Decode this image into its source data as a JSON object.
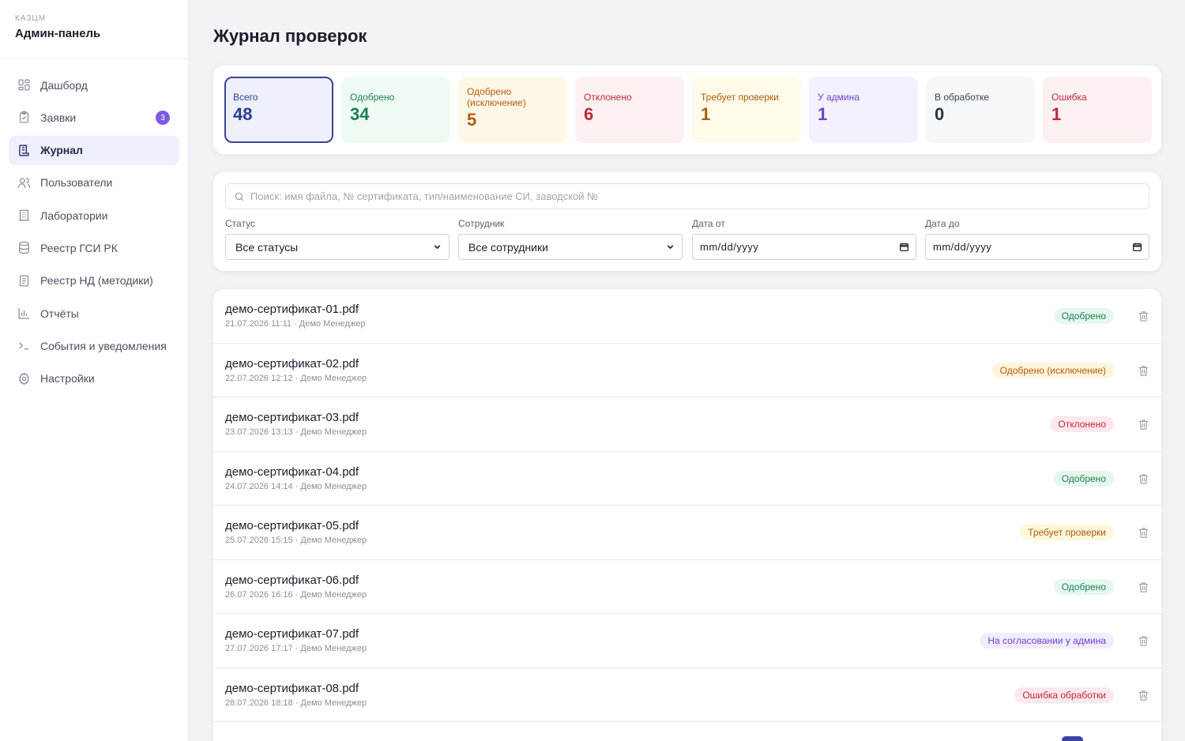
{
  "sidebar": {
    "brand_small": "КАЗЦМ",
    "brand_title": "Админ-панель",
    "items": [
      {
        "label": "Дашборд",
        "icon": "dashboard-icon"
      },
      {
        "label": "Заявки",
        "icon": "clipboard-icon",
        "badge": "3"
      },
      {
        "label": "Журнал",
        "icon": "journal-icon",
        "active": true
      },
      {
        "label": "Пользователи",
        "icon": "users-icon"
      },
      {
        "label": "Лаборатории",
        "icon": "building-icon"
      },
      {
        "label": "Реестр ГСИ РК",
        "icon": "database-icon"
      },
      {
        "label": "Реестр НД (методики)",
        "icon": "document-icon"
      },
      {
        "label": "Отчёты",
        "icon": "bar-chart-icon"
      },
      {
        "label": "События и уведомления",
        "icon": "terminal-icon"
      },
      {
        "label": "Настройки",
        "icon": "gear-icon"
      }
    ]
  },
  "main": {
    "title": "Журнал проверок"
  },
  "stats": [
    {
      "label": "Всего",
      "value": "48",
      "bg": "#eef0fc",
      "fg": "#2c3d8f",
      "label_color": "#2c3d8f"
    },
    {
      "label": "Одобрено",
      "value": "34",
      "bg": "#eefbf3",
      "fg": "#1b7f53",
      "label_color": "#1b7f53"
    },
    {
      "label": "Одобрено (исключение)",
      "value": "5",
      "bg": "#fff8e8",
      "fg": "#b45a09",
      "label_color": "#b45a09"
    },
    {
      "label": "Отклонено",
      "value": "6",
      "bg": "#fdf0f1",
      "fg": "#c2273a",
      "label_color": "#c2273a"
    },
    {
      "label": "Требует проверки",
      "value": "1",
      "bg": "#fffaea",
      "fg": "#a8600a",
      "label_color": "#a8600a"
    },
    {
      "label": "У админа",
      "value": "1",
      "bg": "#f3f1fd",
      "fg": "#6d3fd1",
      "label_color": "#6d3fd1"
    },
    {
      "label": "В обработке",
      "value": "0",
      "bg": "#f6f8fa",
      "fg": "#2b3340",
      "label_color": "#3b4250"
    },
    {
      "label": "Ошибка",
      "value": "1",
      "bg": "#fdf0f1",
      "fg": "#c2273a",
      "label_color": "#c2273a"
    }
  ],
  "filters": {
    "search_placeholder": "Поиск: имя файла, № сертификата, тип/наименование СИ, заводской №",
    "status_label": "Статус",
    "status_value": "Все статусы",
    "employee_label": "Сотрудник",
    "employee_value": "Все сотрудники",
    "date_from_label": "Дата от",
    "date_from_value": "mm/dd/yyyy",
    "date_to_label": "Дата до",
    "date_to_value": "mm/dd/yyyy"
  },
  "rows": [
    {
      "name": "демо-сертификат-01.pdf",
      "meta": "21.07.2026 11:11 · Демо Менеджер",
      "status": "Одобрено",
      "badge_bg": "#e6f7ee",
      "badge_fg": "#1b7f53"
    },
    {
      "name": "демо-сертификат-02.pdf",
      "meta": "22.07.2026 12:12 · Демо Менеджер",
      "status": "Одобрено (исключение)",
      "badge_bg": "#fff4dc",
      "badge_fg": "#b45a09"
    },
    {
      "name": "демо-сертификат-03.pdf",
      "meta": "23.07.2026 13:13 · Демо Менеджер",
      "status": "Отклонено",
      "badge_bg": "#fde9ec",
      "badge_fg": "#c2273a"
    },
    {
      "name": "демо-сертификат-04.pdf",
      "meta": "24.07.2026 14:14 · Демо Менеджер",
      "status": "Одобрено",
      "badge_bg": "#e6f7ee",
      "badge_fg": "#1b7f53"
    },
    {
      "name": "демо-сертификат-05.pdf",
      "meta": "25.07.2026 15:15 · Демо Менеджер",
      "status": "Требует проверки",
      "badge_bg": "#fff6dc",
      "badge_fg": "#a8600a"
    },
    {
      "name": "демо-сертификат-06.pdf",
      "meta": "26.07.2026 16:16 · Демо Менеджер",
      "status": "Одобрено",
      "badge_bg": "#e6f7ee",
      "badge_fg": "#1b7f53"
    },
    {
      "name": "демо-сертификат-07.pdf",
      "meta": "27.07.2026 17:17 · Демо Менеджер",
      "status": "На согласовании у админа",
      "badge_bg": "#f1edfd",
      "badge_fg": "#6d3fd1"
    },
    {
      "name": "демо-сертификат-08.pdf",
      "meta": "28.07.2026 18:18 · Демо Менеджер",
      "status": "Ошибка обработки",
      "badge_bg": "#fde9ec",
      "badge_fg": "#c2273a"
    }
  ]
}
